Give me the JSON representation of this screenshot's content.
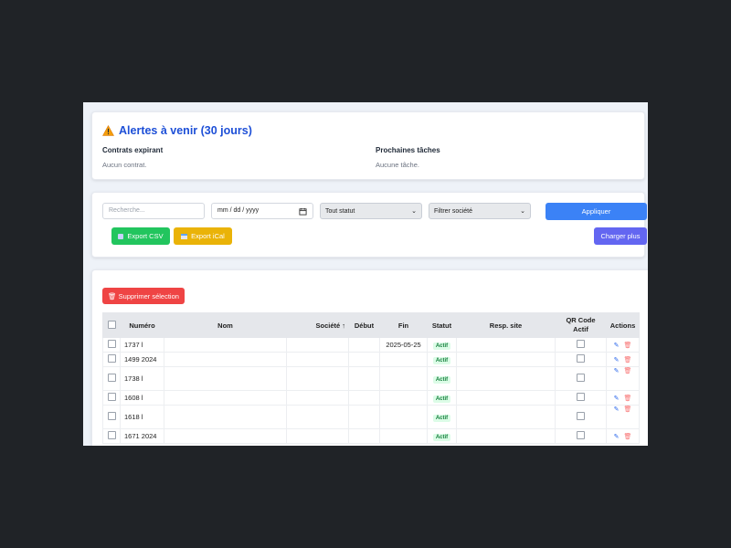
{
  "alerts": {
    "title": "Alertes à venir (30 jours)",
    "contracts_heading": "Contrats expirant",
    "contracts_empty": "Aucun contrat.",
    "tasks_heading": "Prochaines tâches",
    "tasks_empty": "Aucune tâche."
  },
  "filters": {
    "search_placeholder": "Recherche...",
    "date_value": "mm / dd / yyyy",
    "status_select": "Tout statut",
    "company_select": "Filtrer société",
    "apply_label": "Appliquer",
    "export_csv_label": "Export CSV",
    "export_ical_label": "Export iCal",
    "load_more_label": "Charger plus"
  },
  "table": {
    "delete_selection_label": "🗑 Supprimer sélection",
    "headers": {
      "numero": "Numéro",
      "nom": "Nom",
      "societe": "Société ↑",
      "debut": "Début",
      "fin": "Fin",
      "statut": "Statut",
      "resp": "Resp. site",
      "qr": "QR Code Actif",
      "actions": "Actions"
    },
    "rows": [
      {
        "numero": "1737 l",
        "fin": "2025-05-25",
        "statut": "Actif"
      },
      {
        "numero": "1499 2024",
        "fin": "",
        "statut": "Actif"
      },
      {
        "numero": "1738 l",
        "fin": "",
        "statut": "Actif"
      },
      {
        "numero": "1608 l",
        "fin": "",
        "statut": "Actif"
      },
      {
        "numero": "1618 l",
        "fin": "",
        "statut": "Actif"
      },
      {
        "numero": "1671 2024",
        "fin": "",
        "statut": "Actif"
      }
    ]
  },
  "colors": {
    "apply": "#3b82f6",
    "csv": "#22c55e",
    "ical": "#eab308",
    "more": "#6366f1",
    "delete": "#ef4444"
  }
}
